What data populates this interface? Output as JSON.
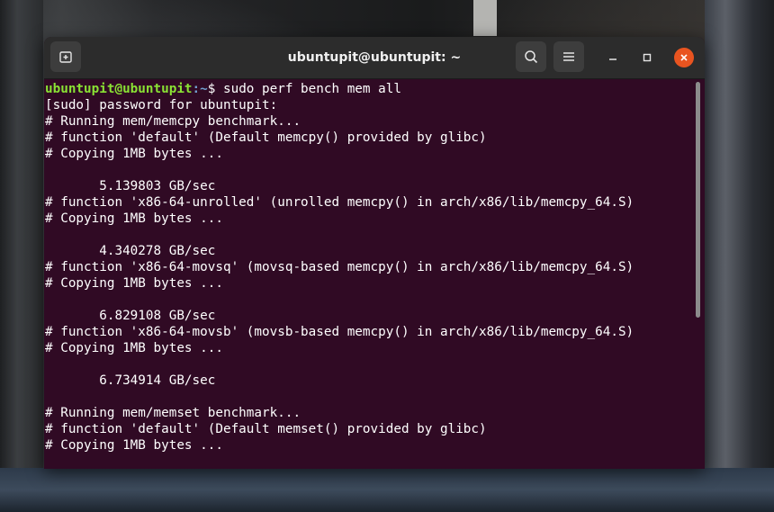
{
  "window": {
    "title": "ubuntupit@ubuntupit: ~"
  },
  "prompt": {
    "user_host": "ubuntupit@ubuntupit",
    "path": ":~",
    "symbol": "$ ",
    "command": "sudo perf bench mem all"
  },
  "output": [
    "[sudo] password for ubuntupit:",
    "# Running mem/memcpy benchmark...",
    "# function 'default' (Default memcpy() provided by glibc)",
    "# Copying 1MB bytes ...",
    "",
    "       5.139803 GB/sec",
    "# function 'x86-64-unrolled' (unrolled memcpy() in arch/x86/lib/memcpy_64.S)",
    "# Copying 1MB bytes ...",
    "",
    "       4.340278 GB/sec",
    "# function 'x86-64-movsq' (movsq-based memcpy() in arch/x86/lib/memcpy_64.S)",
    "# Copying 1MB bytes ...",
    "",
    "       6.829108 GB/sec",
    "# function 'x86-64-movsb' (movsb-based memcpy() in arch/x86/lib/memcpy_64.S)",
    "# Copying 1MB bytes ...",
    "",
    "       6.734914 GB/sec",
    "",
    "# Running mem/memset benchmark...",
    "# function 'default' (Default memset() provided by glibc)",
    "# Copying 1MB bytes ..."
  ],
  "colors": {
    "terminal_bg": "#300a24",
    "prompt_user": "#8ae234",
    "prompt_path": "#729fcf",
    "close_button": "#e95420"
  },
  "icons": {
    "new_tab": "new-tab-icon",
    "search": "search-icon",
    "menu": "hamburger-menu-icon",
    "minimize": "minimize-icon",
    "maximize": "maximize-icon",
    "close": "close-icon"
  }
}
